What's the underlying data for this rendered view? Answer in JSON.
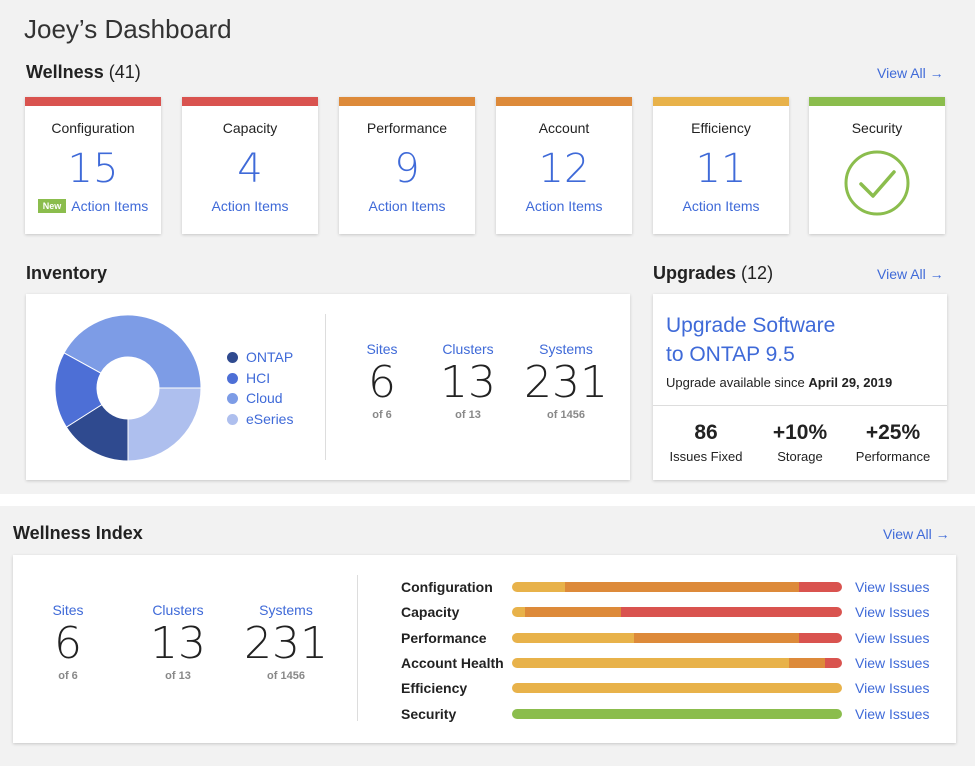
{
  "dashboard_title": "Joey’s Dashboard",
  "colors": {
    "accent": "#3f6ad8",
    "red": "#d9534f",
    "orange": "#dd8a3a",
    "yellow": "#e8b24a",
    "green": "#8bbd4d"
  },
  "wellness": {
    "title": "Wellness",
    "count": "(41)",
    "view_all": "View All →",
    "cards": [
      {
        "title": "Configuration",
        "value": "15",
        "link": "Action Items",
        "badge": "New",
        "status": "red"
      },
      {
        "title": "Capacity",
        "value": "4",
        "link": "Action Items",
        "status": "red"
      },
      {
        "title": "Performance",
        "value": "9",
        "link": "Action Items",
        "status": "orange"
      },
      {
        "title": "Account",
        "value": "12",
        "link": "Action Items",
        "status": "orange"
      },
      {
        "title": "Efficiency",
        "value": "11",
        "link": "Action Items",
        "status": "yellow"
      },
      {
        "title": "Security",
        "icon": "checkmark-circle-icon",
        "status": "green"
      }
    ]
  },
  "inventory": {
    "title": "Inventory",
    "legend": [
      {
        "label": "ONTAP",
        "color": "#2f4a8f"
      },
      {
        "label": "HCI",
        "color": "#4d6fd6"
      },
      {
        "label": "Cloud",
        "color": "#7d9ce6"
      },
      {
        "label": "eSeries",
        "color": "#aebfee"
      }
    ],
    "donut_fractions": [
      0.16,
      0.17,
      0.42,
      0.25
    ],
    "stats": [
      {
        "label": "Sites",
        "value": "6",
        "sub": "of 6"
      },
      {
        "label": "Clusters",
        "value": "13",
        "sub": "of 13"
      },
      {
        "label": "Systems",
        "value": "231",
        "sub": "of 1456"
      }
    ]
  },
  "upgrades": {
    "title": "Upgrades",
    "count": "(12)",
    "view_all": "View All →",
    "headline_1": "Upgrade Software",
    "headline_2": "to ONTAP 9.5",
    "available_text": "Upgrade available since ",
    "available_date": "April 29, 2019",
    "stats": [
      {
        "value": "86",
        "label": "Issues Fixed"
      },
      {
        "value": "+10%",
        "label": "Storage"
      },
      {
        "value": "+25%",
        "label": "Performance"
      }
    ]
  },
  "wellness_index": {
    "title": "Wellness Index",
    "view_all": "View All →",
    "stats": [
      {
        "label": "Sites",
        "value": "6",
        "sub": "of 6"
      },
      {
        "label": "Clusters",
        "value": "13",
        "sub": "of 13"
      },
      {
        "label": "Systems",
        "value": "231",
        "sub": "of 1456"
      }
    ],
    "rows": [
      {
        "label": "Configuration",
        "link": "View Issues",
        "segments": [
          {
            "color": "#e8b24a",
            "fraction": 0.16
          },
          {
            "color": "#dd8a3a",
            "fraction": 0.71
          },
          {
            "color": "#d9534f",
            "fraction": 0.13
          }
        ]
      },
      {
        "label": "Capacity",
        "link": "View Issues",
        "segments": [
          {
            "color": "#e8b24a",
            "fraction": 0.04
          },
          {
            "color": "#dd8a3a",
            "fraction": 0.29
          },
          {
            "color": "#d9534f",
            "fraction": 0.67
          }
        ]
      },
      {
        "label": "Performance",
        "link": "View Issues",
        "segments": [
          {
            "color": "#e8b24a",
            "fraction": 0.37
          },
          {
            "color": "#dd8a3a",
            "fraction": 0.5
          },
          {
            "color": "#d9534f",
            "fraction": 0.13
          }
        ]
      },
      {
        "label": "Account Health",
        "link": "View Issues",
        "segments": [
          {
            "color": "#e8b24a",
            "fraction": 0.84
          },
          {
            "color": "#dd8a3a",
            "fraction": 0.11
          },
          {
            "color": "#d9534f",
            "fraction": 0.05
          }
        ]
      },
      {
        "label": "Efficiency",
        "link": "View Issues",
        "segments": [
          {
            "color": "#e8b24a",
            "fraction": 1.0
          }
        ]
      },
      {
        "label": "Security",
        "link": "View Issues",
        "segments": [
          {
            "color": "#8bbd4d",
            "fraction": 1.0
          }
        ]
      }
    ]
  }
}
